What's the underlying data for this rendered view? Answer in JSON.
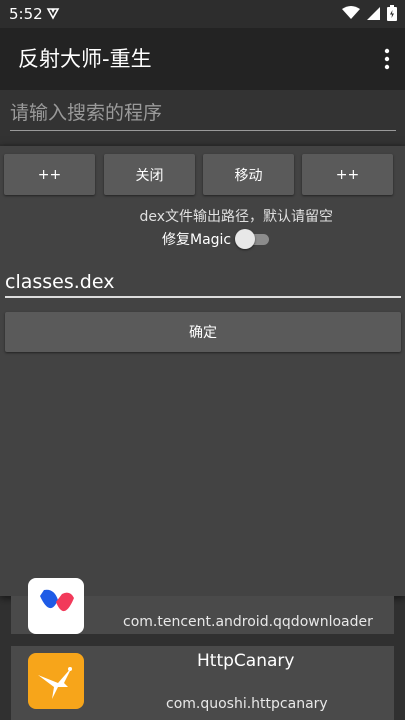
{
  "status": {
    "time": "5:52"
  },
  "app": {
    "title": "反射大师-重生"
  },
  "search": {
    "placeholder": "请输入搜索的程序"
  },
  "dialog": {
    "buttons": [
      "++",
      "关闭",
      "移动",
      "++"
    ],
    "hint": "dex文件输出路径，默认请留空",
    "fix_magic_label": "修复Magic",
    "fix_magic_on": false,
    "path_value": "classes.dex",
    "confirm_label": "确定"
  },
  "apps": [
    {
      "name": "",
      "package": "com.tencent.android.qqdownloader",
      "icon": "yingyongbao-icon"
    },
    {
      "name": "HttpCanary",
      "package": "com.quoshi.httpcanary",
      "icon": "hummingbird-icon"
    }
  ],
  "colors": {
    "appbar": "#232323",
    "dialog": "#434343",
    "button": "#5a5a5a",
    "canary_icon": "#f7a51a"
  }
}
